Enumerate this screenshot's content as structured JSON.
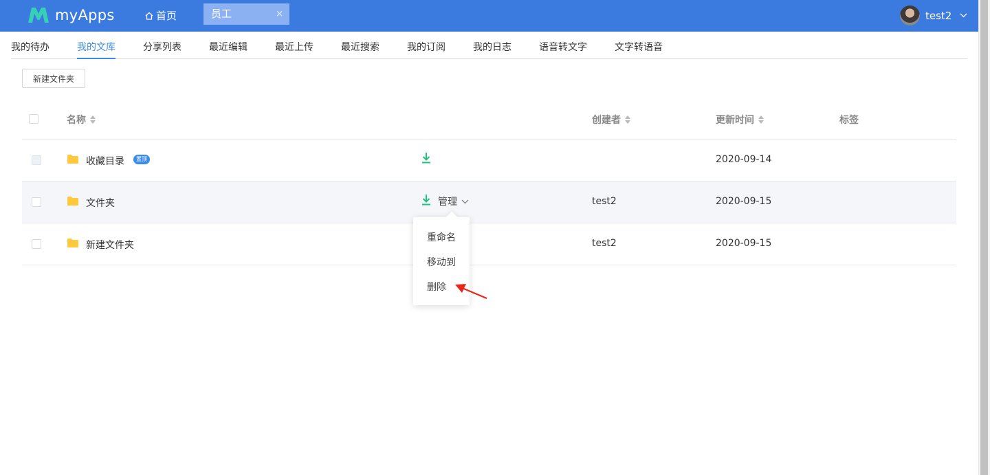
{
  "app": {
    "name": "myApps"
  },
  "header": {
    "home_label": "首页",
    "active_tab": "员工",
    "tab_close": "×",
    "user_name": "test2"
  },
  "nav": {
    "items": [
      "我的待办",
      "我的文库",
      "分享列表",
      "最近编辑",
      "最近上传",
      "最近搜索",
      "我的订阅",
      "我的日志",
      "语音转文字",
      "文字转语音"
    ],
    "active_index": 1
  },
  "toolbar": {
    "new_folder": "新建文件夹"
  },
  "table": {
    "columns": {
      "name": "名称",
      "creator": "创建者",
      "updated": "更新时间",
      "tags": "标签"
    },
    "rows": [
      {
        "name": "收藏目录",
        "badge": "置顶",
        "creator": "",
        "date": "2020-09-14"
      },
      {
        "name": "文件夹",
        "manage": "管理",
        "creator": "test2",
        "date": "2020-09-15"
      },
      {
        "name": "新建文件夹",
        "creator": "test2",
        "date": "2020-09-15"
      }
    ]
  },
  "dropdown": {
    "items": [
      "重命名",
      "移动到",
      "删除"
    ]
  },
  "colors": {
    "header": "#3b7be0",
    "accent": "#3b8ce8",
    "download": "#1ec47a",
    "folder": "#ffc93e",
    "annotation": "#e8271c"
  }
}
